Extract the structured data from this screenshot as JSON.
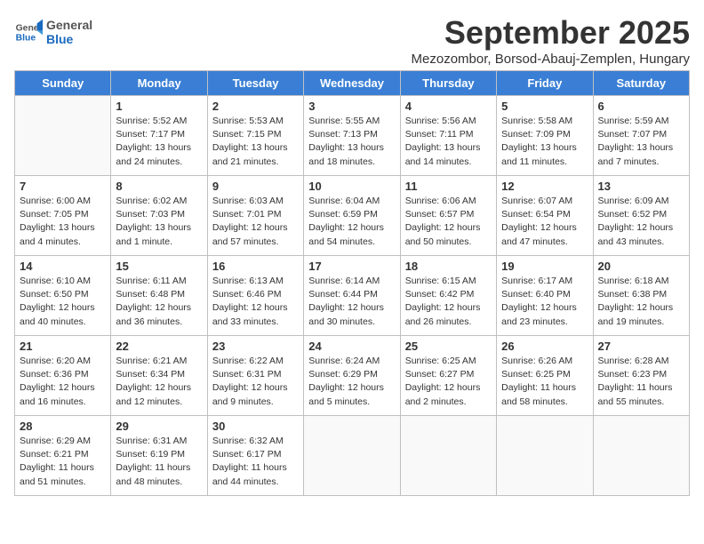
{
  "header": {
    "logo_general": "General",
    "logo_blue": "Blue",
    "month_title": "September 2025",
    "subtitle": "Mezozombor, Borsod-Abauj-Zemplen, Hungary"
  },
  "days_of_week": [
    "Sunday",
    "Monday",
    "Tuesday",
    "Wednesday",
    "Thursday",
    "Friday",
    "Saturday"
  ],
  "weeks": [
    [
      {
        "day": "",
        "info": ""
      },
      {
        "day": "1",
        "info": "Sunrise: 5:52 AM\nSunset: 7:17 PM\nDaylight: 13 hours\nand 24 minutes."
      },
      {
        "day": "2",
        "info": "Sunrise: 5:53 AM\nSunset: 7:15 PM\nDaylight: 13 hours\nand 21 minutes."
      },
      {
        "day": "3",
        "info": "Sunrise: 5:55 AM\nSunset: 7:13 PM\nDaylight: 13 hours\nand 18 minutes."
      },
      {
        "day": "4",
        "info": "Sunrise: 5:56 AM\nSunset: 7:11 PM\nDaylight: 13 hours\nand 14 minutes."
      },
      {
        "day": "5",
        "info": "Sunrise: 5:58 AM\nSunset: 7:09 PM\nDaylight: 13 hours\nand 11 minutes."
      },
      {
        "day": "6",
        "info": "Sunrise: 5:59 AM\nSunset: 7:07 PM\nDaylight: 13 hours\nand 7 minutes."
      }
    ],
    [
      {
        "day": "7",
        "info": "Sunrise: 6:00 AM\nSunset: 7:05 PM\nDaylight: 13 hours\nand 4 minutes."
      },
      {
        "day": "8",
        "info": "Sunrise: 6:02 AM\nSunset: 7:03 PM\nDaylight: 13 hours\nand 1 minute."
      },
      {
        "day": "9",
        "info": "Sunrise: 6:03 AM\nSunset: 7:01 PM\nDaylight: 12 hours\nand 57 minutes."
      },
      {
        "day": "10",
        "info": "Sunrise: 6:04 AM\nSunset: 6:59 PM\nDaylight: 12 hours\nand 54 minutes."
      },
      {
        "day": "11",
        "info": "Sunrise: 6:06 AM\nSunset: 6:57 PM\nDaylight: 12 hours\nand 50 minutes."
      },
      {
        "day": "12",
        "info": "Sunrise: 6:07 AM\nSunset: 6:54 PM\nDaylight: 12 hours\nand 47 minutes."
      },
      {
        "day": "13",
        "info": "Sunrise: 6:09 AM\nSunset: 6:52 PM\nDaylight: 12 hours\nand 43 minutes."
      }
    ],
    [
      {
        "day": "14",
        "info": "Sunrise: 6:10 AM\nSunset: 6:50 PM\nDaylight: 12 hours\nand 40 minutes."
      },
      {
        "day": "15",
        "info": "Sunrise: 6:11 AM\nSunset: 6:48 PM\nDaylight: 12 hours\nand 36 minutes."
      },
      {
        "day": "16",
        "info": "Sunrise: 6:13 AM\nSunset: 6:46 PM\nDaylight: 12 hours\nand 33 minutes."
      },
      {
        "day": "17",
        "info": "Sunrise: 6:14 AM\nSunset: 6:44 PM\nDaylight: 12 hours\nand 30 minutes."
      },
      {
        "day": "18",
        "info": "Sunrise: 6:15 AM\nSunset: 6:42 PM\nDaylight: 12 hours\nand 26 minutes."
      },
      {
        "day": "19",
        "info": "Sunrise: 6:17 AM\nSunset: 6:40 PM\nDaylight: 12 hours\nand 23 minutes."
      },
      {
        "day": "20",
        "info": "Sunrise: 6:18 AM\nSunset: 6:38 PM\nDaylight: 12 hours\nand 19 minutes."
      }
    ],
    [
      {
        "day": "21",
        "info": "Sunrise: 6:20 AM\nSunset: 6:36 PM\nDaylight: 12 hours\nand 16 minutes."
      },
      {
        "day": "22",
        "info": "Sunrise: 6:21 AM\nSunset: 6:34 PM\nDaylight: 12 hours\nand 12 minutes."
      },
      {
        "day": "23",
        "info": "Sunrise: 6:22 AM\nSunset: 6:31 PM\nDaylight: 12 hours\nand 9 minutes."
      },
      {
        "day": "24",
        "info": "Sunrise: 6:24 AM\nSunset: 6:29 PM\nDaylight: 12 hours\nand 5 minutes."
      },
      {
        "day": "25",
        "info": "Sunrise: 6:25 AM\nSunset: 6:27 PM\nDaylight: 12 hours\nand 2 minutes."
      },
      {
        "day": "26",
        "info": "Sunrise: 6:26 AM\nSunset: 6:25 PM\nDaylight: 11 hours\nand 58 minutes."
      },
      {
        "day": "27",
        "info": "Sunrise: 6:28 AM\nSunset: 6:23 PM\nDaylight: 11 hours\nand 55 minutes."
      }
    ],
    [
      {
        "day": "28",
        "info": "Sunrise: 6:29 AM\nSunset: 6:21 PM\nDaylight: 11 hours\nand 51 minutes."
      },
      {
        "day": "29",
        "info": "Sunrise: 6:31 AM\nSunset: 6:19 PM\nDaylight: 11 hours\nand 48 minutes."
      },
      {
        "day": "30",
        "info": "Sunrise: 6:32 AM\nSunset: 6:17 PM\nDaylight: 11 hours\nand 44 minutes."
      },
      {
        "day": "",
        "info": ""
      },
      {
        "day": "",
        "info": ""
      },
      {
        "day": "",
        "info": ""
      },
      {
        "day": "",
        "info": ""
      }
    ]
  ]
}
